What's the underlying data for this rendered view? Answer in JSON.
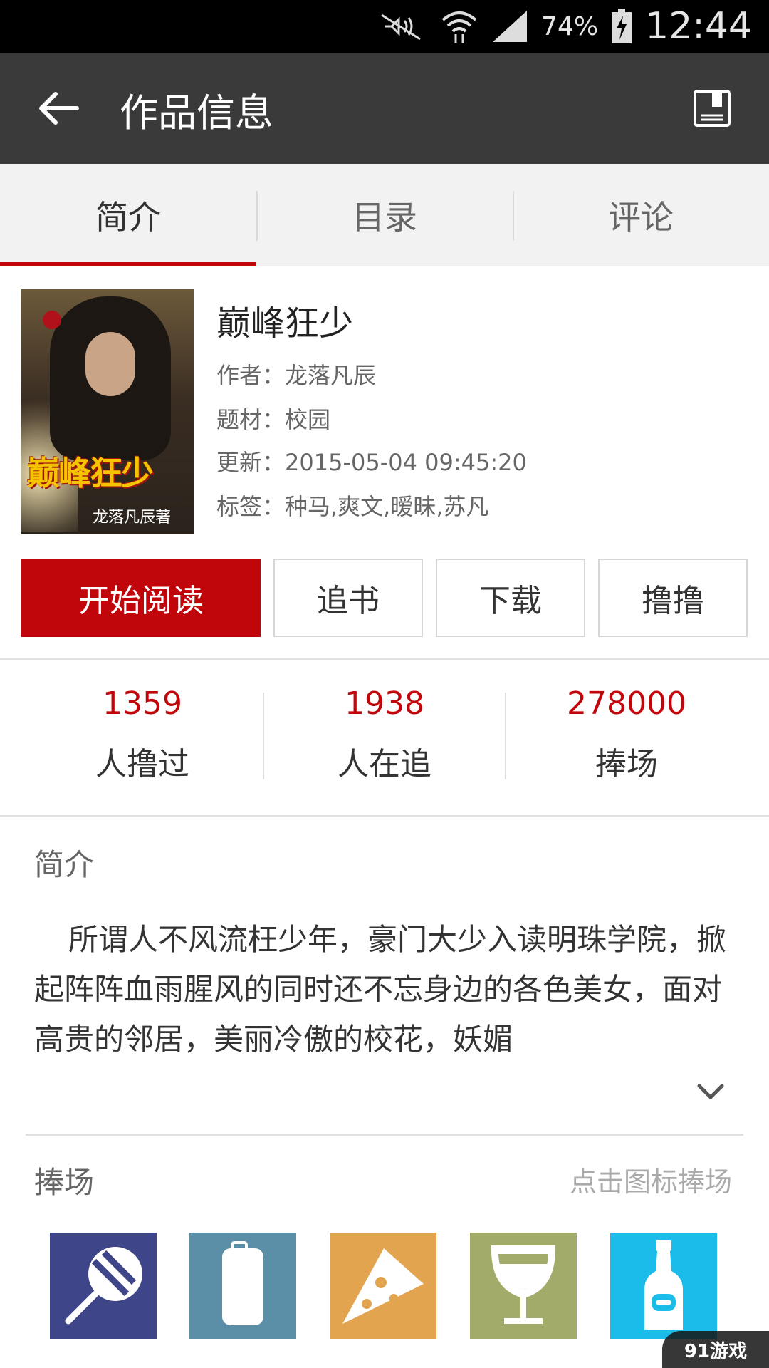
{
  "status_bar": {
    "battery": "74%",
    "time": "12:44"
  },
  "toolbar": {
    "title": "作品信息"
  },
  "tabs": [
    {
      "label": "简介",
      "active": true
    },
    {
      "label": "目录",
      "active": false
    },
    {
      "label": "评论",
      "active": false
    }
  ],
  "book": {
    "title": "巅峰狂少",
    "cover_title": "巅峰狂少",
    "cover_author": "龙落凡辰著",
    "author": "作者：龙落凡辰",
    "genre": "题材：校园",
    "updated": "更新：2015-05-04 09:45:20",
    "tags": "标签：种马,爽文,暧昧,苏凡"
  },
  "actions": {
    "read": "开始阅读",
    "follow": "追书",
    "download": "下载",
    "lulu": "撸撸"
  },
  "stats": [
    {
      "value": "1359",
      "label": "人撸过"
    },
    {
      "value": "1938",
      "label": "人在追"
    },
    {
      "value": "278000",
      "label": "捧场"
    }
  ],
  "intro": {
    "heading": "简介",
    "text": "所谓人不风流枉少年，豪门大少入读明珠学院，掀起阵阵血雨腥风的同时还不忘身边的各色美女，面对高贵的邻居，美丽冷傲的校花，妖媚"
  },
  "support": {
    "heading": "捧场",
    "hint": "点击图标捧场",
    "gifts": [
      {
        "label": "棒棒糖",
        "color": "#3f4589",
        "icon": "lollipop-icon"
      },
      {
        "label": "红牛",
        "color": "#5b8fa8",
        "icon": "can-icon"
      },
      {
        "label": "披萨",
        "color": "#e3a44f",
        "icon": "pizza-icon"
      },
      {
        "label": "红酒",
        "color": "#a3ab6a",
        "icon": "wine-glass-icon"
      },
      {
        "label": "白酒",
        "color": "#1bbcea",
        "icon": "bottle-icon"
      }
    ]
  },
  "colors": {
    "accent": "#c0050b",
    "toolbar": "#3a3a3a",
    "tabs_bg": "#f2f2f2"
  },
  "watermark": "91游戏"
}
